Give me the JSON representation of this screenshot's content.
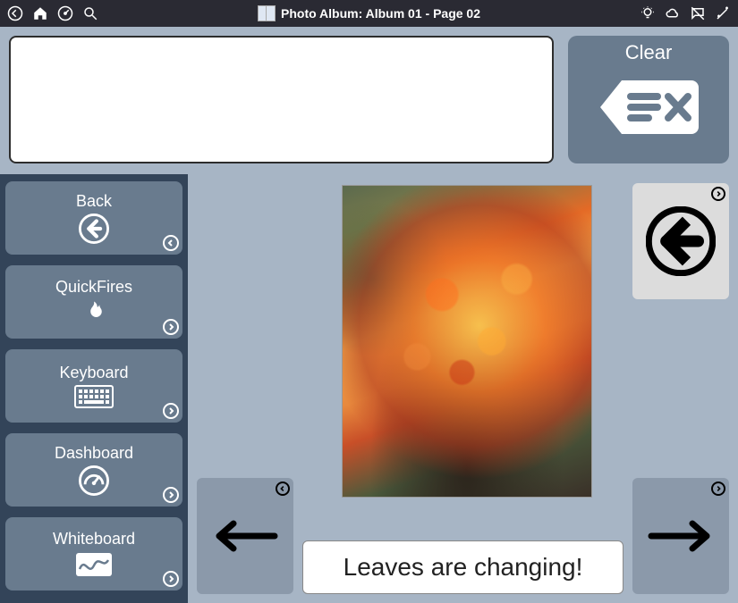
{
  "topbar": {
    "title": "Photo Album: Album 01 - Page 02"
  },
  "message_box": {
    "value": ""
  },
  "clear": {
    "label": "Clear"
  },
  "sidebar": [
    {
      "label": "Back",
      "icon": "back-icon",
      "corner": "left"
    },
    {
      "label": "QuickFires",
      "icon": "fire-icon",
      "corner": "right"
    },
    {
      "label": "Keyboard",
      "icon": "keyboard-icon",
      "corner": "right"
    },
    {
      "label": "Dashboard",
      "icon": "gauge-icon",
      "corner": "right"
    },
    {
      "label": "Whiteboard",
      "icon": "whiteboard-icon",
      "corner": "right"
    }
  ],
  "photo": {
    "alt": "Autumn shrub with orange and red leaves"
  },
  "caption": "Leaves are changing!",
  "nav": {
    "prev_alt": "Previous page",
    "next_alt": "Next page",
    "big_back_alt": "Back"
  }
}
